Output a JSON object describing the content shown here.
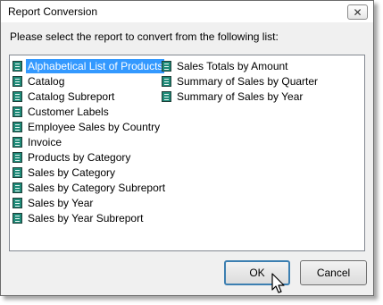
{
  "window": {
    "title": "Report Conversion",
    "close_glyph": "✕"
  },
  "prompt": "Please select the report to convert from the following list:",
  "list": {
    "icon": "report-icon",
    "selected_index": 0,
    "column1": [
      "Alphabetical List of Products",
      "Catalog",
      "Catalog Subreport",
      "Customer Labels",
      "Employee Sales by Country",
      "Invoice",
      "Products by Category",
      "Sales by Category",
      "Sales by Category Subreport",
      "Sales by Year",
      "Sales by Year Subreport"
    ],
    "column2": [
      "Sales Totals by Amount",
      "Summary of Sales by Quarter",
      "Summary of Sales by Year"
    ]
  },
  "buttons": {
    "ok": "OK",
    "cancel": "Cancel"
  },
  "colors": {
    "selection": "#3399ff",
    "icon": "#1e8a78"
  }
}
